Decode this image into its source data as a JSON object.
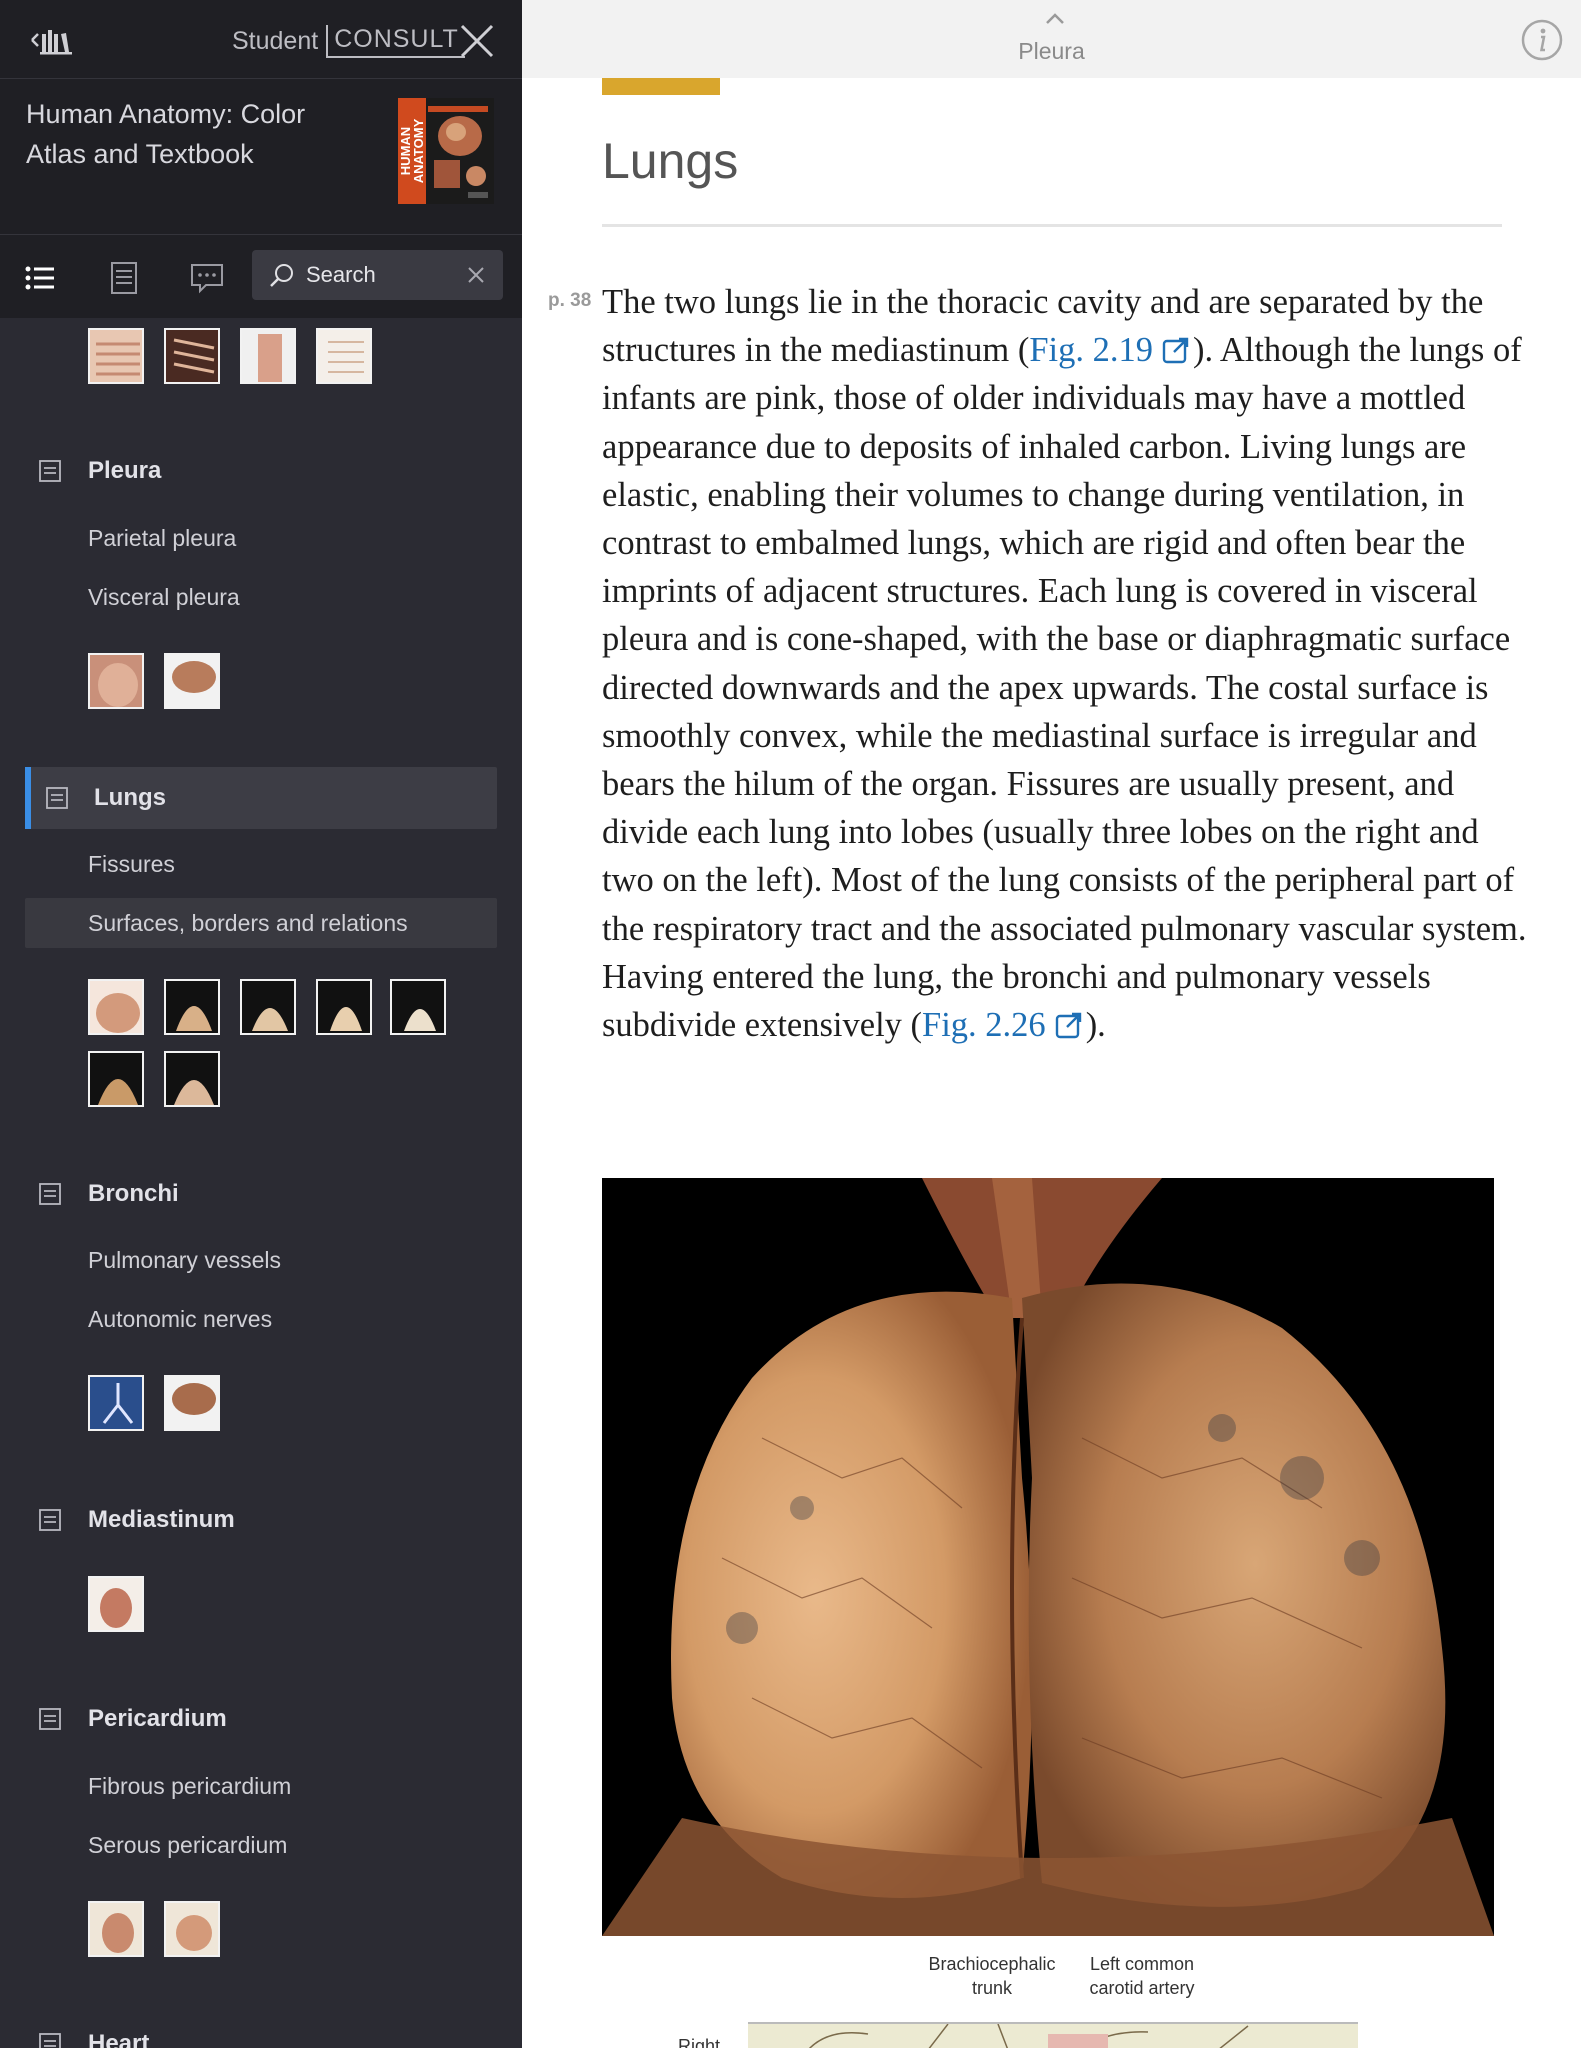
{
  "sidebar": {
    "brand": {
      "student": "Student",
      "consult": "CONSULT"
    },
    "book_title": "Human Anatomy: Color Atlas and Textbook",
    "cover_text": "HUMAN ANATOMY",
    "search": {
      "placeholder": "Search",
      "value": ""
    },
    "toc": {
      "pleura": {
        "label": "Pleura",
        "subs": [
          "Parietal pleura",
          "Visceral pleura"
        ]
      },
      "lungs": {
        "label": "Lungs",
        "subs": [
          "Fissures",
          "Surfaces, borders and relations"
        ]
      },
      "bronchi": {
        "label": "Bronchi",
        "subs": [
          "Pulmonary vessels",
          "Autonomic nerves"
        ]
      },
      "mediastinum": {
        "label": "Mediastinum"
      },
      "pericardium": {
        "label": "Pericardium",
        "subs": [
          "Fibrous pericardium",
          "Serous pericardium"
        ]
      },
      "heart": {
        "label": "Heart"
      }
    },
    "active_section": "Lungs",
    "highlighted_subsection": "Surfaces, borders and relations"
  },
  "reader": {
    "prev_section": "Pleura",
    "chapter_title": "Lungs",
    "page_marker": "p. 38",
    "paragraph": {
      "t1": "The two lungs lie in the thoracic cavity and are separated by the structures in the mediastinum (",
      "link1": "Fig. 2.19",
      "t2": "). Although the lungs of infants are pink, those of older individuals may have a mottled appearance due to deposits of inhaled carbon. Living lungs are elastic, enabling their volumes to change during ventilation, in contrast to embalmed lungs, which are rigid and often bear the imprints of adjacent structures. Each lung is covered in visceral pleura and is cone-shaped, with the base or diaphragmatic surface directed downwards and the apex upwards. The costal surface is smoothly convex, while the mediastinal surface is irregular and bears the hilum of the organ. Fissures are usually present, and divide each lung into lobes (usually three lobes on the right and two on the left). Most of the lung consists of the peripheral part of the respiratory tract and the associated pulmonary vascular system. Having entered the lung, the bronchi and pulmonary vessels subdivide extensively (",
      "link2": "Fig. 2.26",
      "t3": ")."
    },
    "figure_labels": {
      "brachiocephalic": "Brachiocephalic trunk",
      "left_common_carotid": "Left common carotid artery",
      "right_partial": "Right"
    }
  },
  "colors": {
    "sidebar_bg": "#2b2b33",
    "sidebar_header_bg": "#1f1f24",
    "accent_blue": "#3a8ee6",
    "link_blue": "#1e6fb5",
    "chapter_accent": "#d9a62d"
  },
  "icons": {
    "library": "library-back-icon",
    "close": "close-icon",
    "toc": "list-icon",
    "notes": "notes-icon",
    "comments": "comment-icon",
    "search": "search-icon",
    "section": "section-page-icon",
    "info": "info-icon",
    "external": "external-link-icon",
    "chevron": "chevron-up-icon"
  }
}
